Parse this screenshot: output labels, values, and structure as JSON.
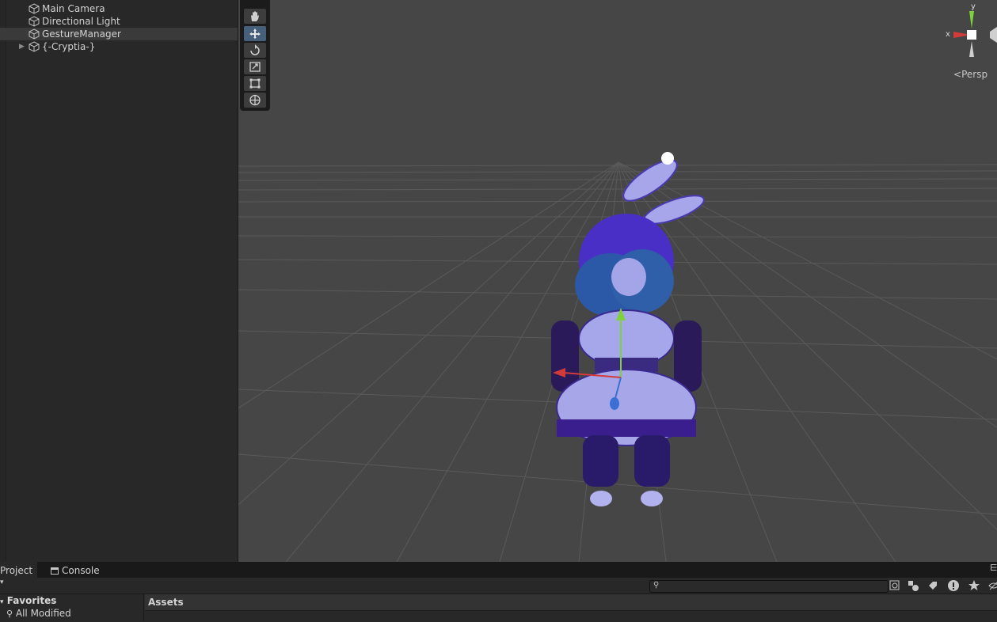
{
  "hierarchy": {
    "items": [
      {
        "label": "Main Camera",
        "icon": "cube-icon",
        "selected": false,
        "expandable": false
      },
      {
        "label": "Directional Light",
        "icon": "cube-icon",
        "selected": false,
        "expandable": false
      },
      {
        "label": "GestureManager",
        "icon": "cube-icon",
        "selected": true,
        "expandable": false
      },
      {
        "label": "{-Cryptia-}",
        "icon": "cube-icon",
        "selected": false,
        "expandable": true
      }
    ]
  },
  "scene": {
    "tools": [
      "hand-tool-icon",
      "move-tool-icon",
      "rotate-tool-icon",
      "scale-tool-icon",
      "rect-tool-icon",
      "transform-tool-icon"
    ],
    "active_tool": "move-tool-icon",
    "gizmo": {
      "y_label": "y",
      "x_label": "x",
      "projection_label": "Persp"
    },
    "colors": {
      "background": "#464646",
      "grid": "#5a5a5a",
      "x_axis": "#d33b3b",
      "y_axis": "#7fd13b",
      "z_axis": "#3b6fd3"
    }
  },
  "bottom": {
    "tabs": [
      {
        "label": "Project",
        "icon": "folder-icon"
      },
      {
        "label": "Console",
        "icon": "console-icon"
      }
    ],
    "favorites": {
      "header": "Favorites",
      "items": [
        "All Modified"
      ]
    },
    "assets_header": "Assets"
  }
}
